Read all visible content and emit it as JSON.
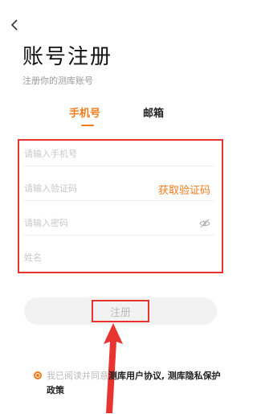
{
  "header": {
    "back_icon": "chevron-left-icon",
    "title": "账号注册",
    "subtitle": "注册你的测库账号"
  },
  "tabs": [
    {
      "label": "手机号",
      "active": true
    },
    {
      "label": "邮箱",
      "active": false
    }
  ],
  "form": {
    "phone_placeholder": "请输入手机号",
    "code_placeholder": "请输入验证码",
    "get_code_label": "获取验证码",
    "password_placeholder": "请输入密码",
    "password_toggle_icon": "eye-slash-icon",
    "name_placeholder": "姓名"
  },
  "register_label": "注册",
  "agreement": {
    "prefix": "我已阅读并同意",
    "user_agreement": "测库用户协议,",
    "privacy_policy": "测库隐私保护政策",
    "checked": true
  },
  "colors": {
    "accent": "#f07c1e",
    "annotation_red": "#e8342f",
    "button_bg": "#f2f2f2"
  }
}
